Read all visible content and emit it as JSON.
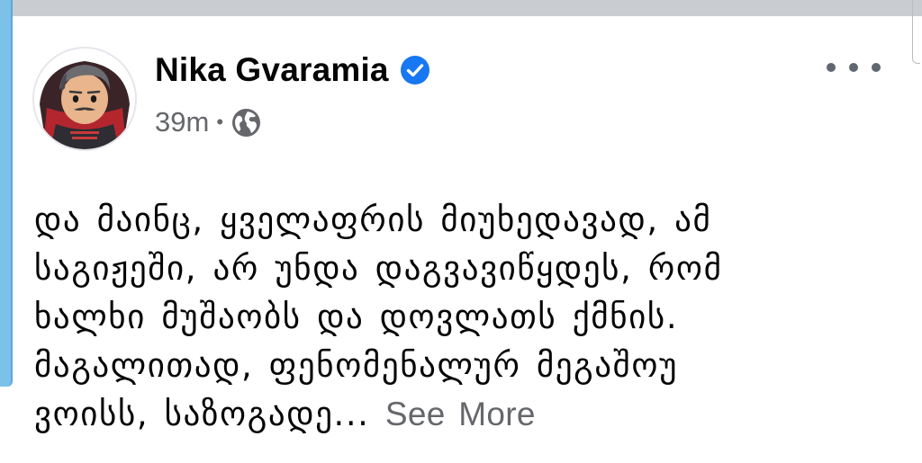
{
  "post": {
    "author_name": "Nika Gvaramia",
    "verified": true,
    "timestamp": "39m",
    "separator": "•",
    "audience_icon": "globe-icon",
    "more_icon": "more-options-icon",
    "text_lines": [
      "და მაინც, ყველაფრის მიუხედავად, ამ",
      "საგიჟეში, არ უნდა დაგვავიწყდეს, რომ",
      "ხალხი მუშაობს და დოვლათს ქმნის.",
      "მაგალითად, ფენომენალურ მეგაშოუ",
      "ვოისს, საზოგადე..."
    ],
    "see_more_label": "See More",
    "colors": {
      "verified_badge": "#1877f2",
      "secondary_text": "#65676b",
      "primary_text": "#050505",
      "left_accent": "#7cc1ea"
    }
  }
}
